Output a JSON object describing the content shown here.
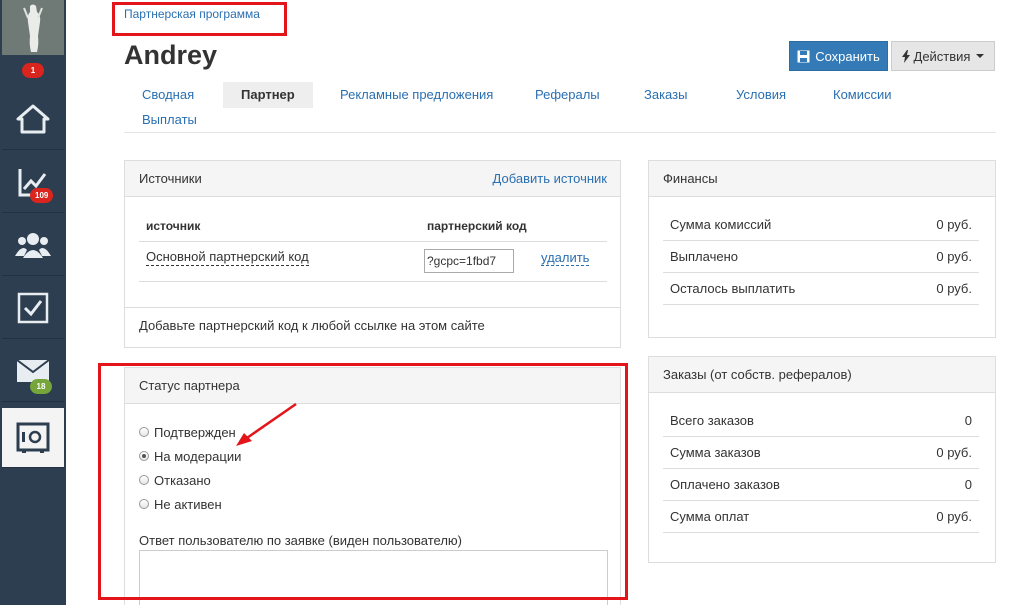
{
  "sidebar": {
    "badges": {
      "notifications": "1",
      "stats": "109",
      "mail": "18"
    }
  },
  "header": {
    "breadcrumb": "Партнерская программа",
    "title": "Andrey",
    "save_label": "Сохранить",
    "actions_label": "Действия"
  },
  "tabs": [
    {
      "label": "Сводная"
    },
    {
      "label": "Партнер"
    },
    {
      "label": "Рекламные предложения"
    },
    {
      "label": "Рефералы"
    },
    {
      "label": "Заказы"
    },
    {
      "label": "Условия"
    },
    {
      "label": "Комиссии"
    },
    {
      "label": "Выплаты"
    }
  ],
  "sources": {
    "title": "Источники",
    "add_link": "Добавить источник",
    "col_source": "источник",
    "col_code": "партнерский код",
    "row_name": "Основной партнерский код",
    "row_code": "?gcpc=1fbd7",
    "row_delete": "удалить",
    "hint": "Добавьте партнерский код к любой ссылке на этом сайте"
  },
  "status": {
    "title": "Статус партнера",
    "options": [
      "Подтвержден",
      "На модерации",
      "Отказано",
      "Не активен"
    ],
    "selected": "На модерации",
    "reply_label": "Ответ пользователю по заявке (виден пользователю)"
  },
  "finance": {
    "title": "Финансы",
    "rows": [
      {
        "label": "Сумма комиссий",
        "value": "0 руб."
      },
      {
        "label": "Выплачено",
        "value": "0 руб."
      },
      {
        "label": "Осталось выплатить",
        "value": "0 руб."
      }
    ]
  },
  "orders": {
    "title": "Заказы (от собств. рефералов)",
    "rows": [
      {
        "label": "Всего заказов",
        "value": "0"
      },
      {
        "label": "Сумма заказов",
        "value": "0 руб."
      },
      {
        "label": "Оплачено заказов",
        "value": "0"
      },
      {
        "label": "Сумма оплат",
        "value": "0 руб."
      }
    ]
  },
  "colors": {
    "sidebar": "#2d3e50",
    "link": "#2a6fb0",
    "primary": "#337ab7",
    "highlight": "#e3141a"
  }
}
